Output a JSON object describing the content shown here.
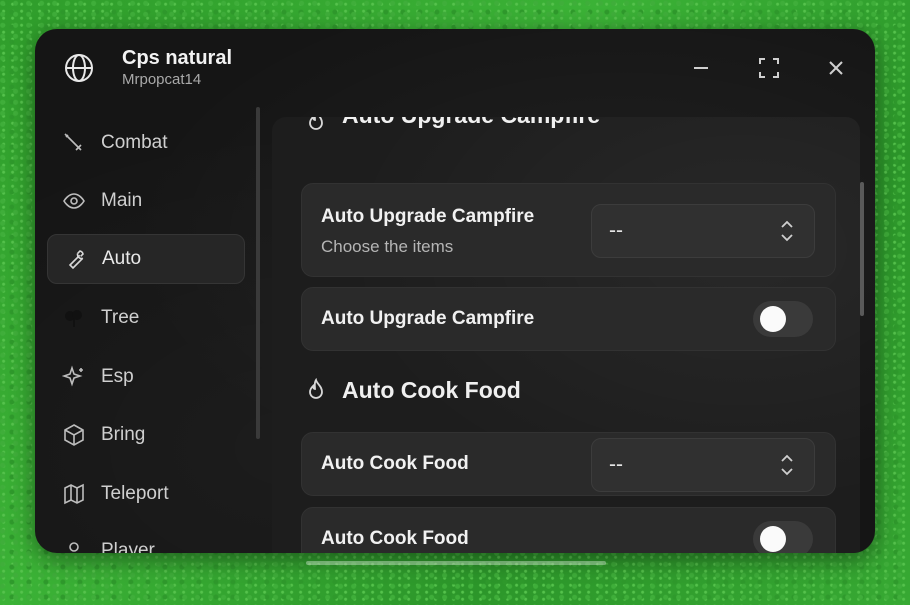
{
  "window": {
    "title": "Cps natural",
    "subtitle": "Mrpopcat14",
    "icon": "globe-icon",
    "controls": [
      "minimize-icon",
      "maximize-icon",
      "close-icon"
    ]
  },
  "sidebar": {
    "items": [
      {
        "label": "Combat",
        "icon": "sword-icon",
        "active": false
      },
      {
        "label": "Main",
        "icon": "eye-icon",
        "active": false
      },
      {
        "label": "Auto",
        "icon": "wrench-icon",
        "active": true
      },
      {
        "label": "Tree",
        "icon": "tree-icon",
        "active": false
      },
      {
        "label": "Esp",
        "icon": "sparkles-icon",
        "active": false
      },
      {
        "label": "Bring",
        "icon": "box-icon",
        "active": false
      },
      {
        "label": "Teleport",
        "icon": "map-icon",
        "active": false
      },
      {
        "label": "Player",
        "icon": "user-icon",
        "active": false
      }
    ]
  },
  "main": {
    "section1": {
      "title": "Auto Upgrade Campfire",
      "icon": "flame-icon",
      "dropdown": {
        "label": "Auto Upgrade Campfire",
        "description": "Choose the items",
        "value": "--"
      },
      "toggle": {
        "label": "Auto Upgrade Campfire",
        "on": false
      }
    },
    "section2": {
      "title": "Auto Cook Food",
      "icon": "flame-icon",
      "dropdown": {
        "label": "Auto Cook Food",
        "value": "--"
      },
      "toggle": {
        "label": "Auto Cook Food",
        "on": false
      }
    }
  },
  "colors": {
    "background": "#33a82f",
    "window": "#151515",
    "card": "#2a2a2a",
    "text": "#f1f1f1",
    "muted": "#a9a9a9"
  }
}
